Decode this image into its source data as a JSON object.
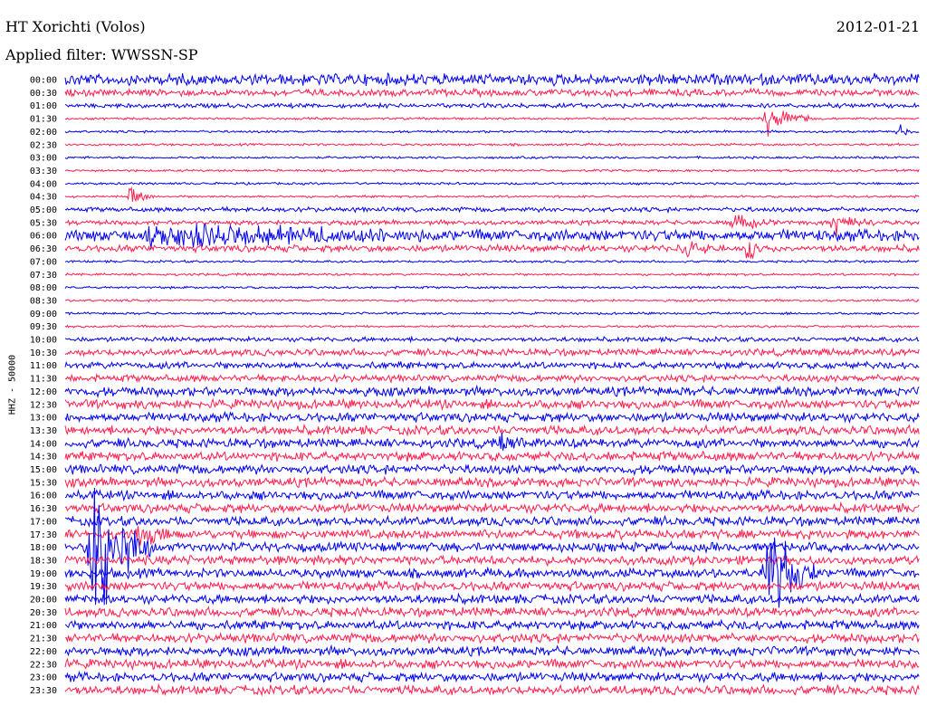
{
  "header": {
    "station_title": "HT Xorichti (Volos)",
    "date": "2012-01-21",
    "filter_label": "Applied filter: WWSSN-SP"
  },
  "chart_data": {
    "type": "line",
    "title": "HT Xorichti (Volos)",
    "subtitle": "Applied filter: WWSSN-SP",
    "date": "2012-01-21",
    "ylabel": "HHZ - 50000",
    "xlabel": "",
    "row_labels": [
      "00:00",
      "00:30",
      "01:00",
      "01:30",
      "02:00",
      "02:30",
      "03:00",
      "03:30",
      "04:00",
      "04:30",
      "05:00",
      "05:30",
      "06:00",
      "06:30",
      "07:00",
      "07:30",
      "08:00",
      "08:30",
      "09:00",
      "09:30",
      "10:00",
      "10:30",
      "11:00",
      "11:30",
      "12:00",
      "12:30",
      "13:00",
      "13:30",
      "14:00",
      "14:30",
      "15:00",
      "15:30",
      "16:00",
      "16:30",
      "17:00",
      "17:30",
      "18:00",
      "18:30",
      "19:00",
      "19:30",
      "20:00",
      "20:30",
      "21:00",
      "21:30",
      "22:00",
      "22:30",
      "23:00",
      "23:30"
    ],
    "row_minutes": 30,
    "colors": [
      "#0000ee",
      "#ff1e4e"
    ],
    "grid": false,
    "noise_by_row": [
      5,
      3,
      2,
      1,
      1,
      1,
      1,
      1,
      1,
      1,
      2,
      2,
      5,
      3,
      1,
      1,
      1,
      1,
      1,
      1,
      2,
      3,
      3,
      3,
      4,
      4,
      4,
      4,
      4,
      4,
      4,
      4,
      4,
      4,
      4,
      4,
      4,
      4,
      4,
      4,
      4,
      4,
      4,
      4,
      4,
      4,
      4,
      4
    ],
    "events": [
      {
        "row": 9,
        "x": 0.075,
        "amp": 14,
        "dur": 0.02
      },
      {
        "row": 3,
        "x": 0.82,
        "amp": 40,
        "dur": 0.03
      },
      {
        "row": 4,
        "x": 0.975,
        "amp": 12,
        "dur": 0.01
      },
      {
        "row": 12,
        "x": 0.1,
        "amp": 14,
        "dur": 0.3
      },
      {
        "row": 11,
        "x": 0.78,
        "amp": 14,
        "dur": 0.03
      },
      {
        "row": 11,
        "x": 0.9,
        "amp": 20,
        "dur": 0.03
      },
      {
        "row": 13,
        "x": 0.72,
        "amp": 12,
        "dur": 0.03
      },
      {
        "row": 13,
        "x": 0.8,
        "amp": 60,
        "dur": 0.005
      },
      {
        "row": 28,
        "x": 0.51,
        "amp": 16,
        "dur": 0.02
      },
      {
        "row": 36,
        "x": 0.03,
        "amp": 120,
        "dur": 0.05
      },
      {
        "row": 38,
        "x": 0.82,
        "amp": 80,
        "dur": 0.04
      },
      {
        "row": 35,
        "x": 0.085,
        "amp": 14,
        "dur": 0.03
      }
    ]
  }
}
